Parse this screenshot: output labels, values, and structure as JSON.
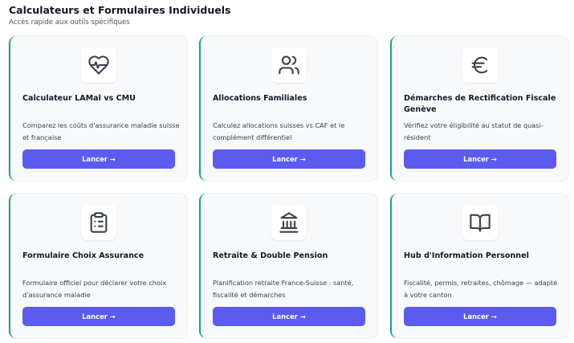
{
  "header": {
    "title": "Calculateurs et Formulaires Individuels",
    "subtitle": "Accès rapide aux outils spécifiques"
  },
  "colors": {
    "accent_border": "#17a589",
    "button_bg": "#5b5bf0",
    "card_bg": "#f8f9fb",
    "icon_stroke": "#374151"
  },
  "cards": [
    {
      "icon": "heart-pulse-icon",
      "title": "Calculateur LAMal vs CMU",
      "description": "Comparez les coûts d'assurance maladie suisse et française",
      "button": "Lancer →"
    },
    {
      "icon": "users-icon",
      "title": "Allocations Familiales",
      "description": "Calculez allocations suisses vs CAF et le complément différentiel",
      "button": "Lancer →"
    },
    {
      "icon": "euro-icon",
      "title": "Démarches de Rectification Fiscale Genève",
      "description": "Vérifiez votre éligibilité au statut de quasi-résident",
      "button": "Lancer →"
    },
    {
      "icon": "clipboard-list-icon",
      "title": "Formulaire Choix Assurance",
      "description": "Formulaire officiel pour déclarer votre choix d'assurance maladie",
      "button": "Lancer →"
    },
    {
      "icon": "landmark-icon",
      "title": "Retraite & Double Pension",
      "description": "Planification retraite France-Suisse : santé, fiscalité et démarches",
      "button": "Lancer →"
    },
    {
      "icon": "book-open-icon",
      "title": "Hub d'Information Personnel",
      "description": "Fiscalité, permis, retraites, chômage — adapté à votre canton",
      "button": "Lancer →"
    }
  ]
}
